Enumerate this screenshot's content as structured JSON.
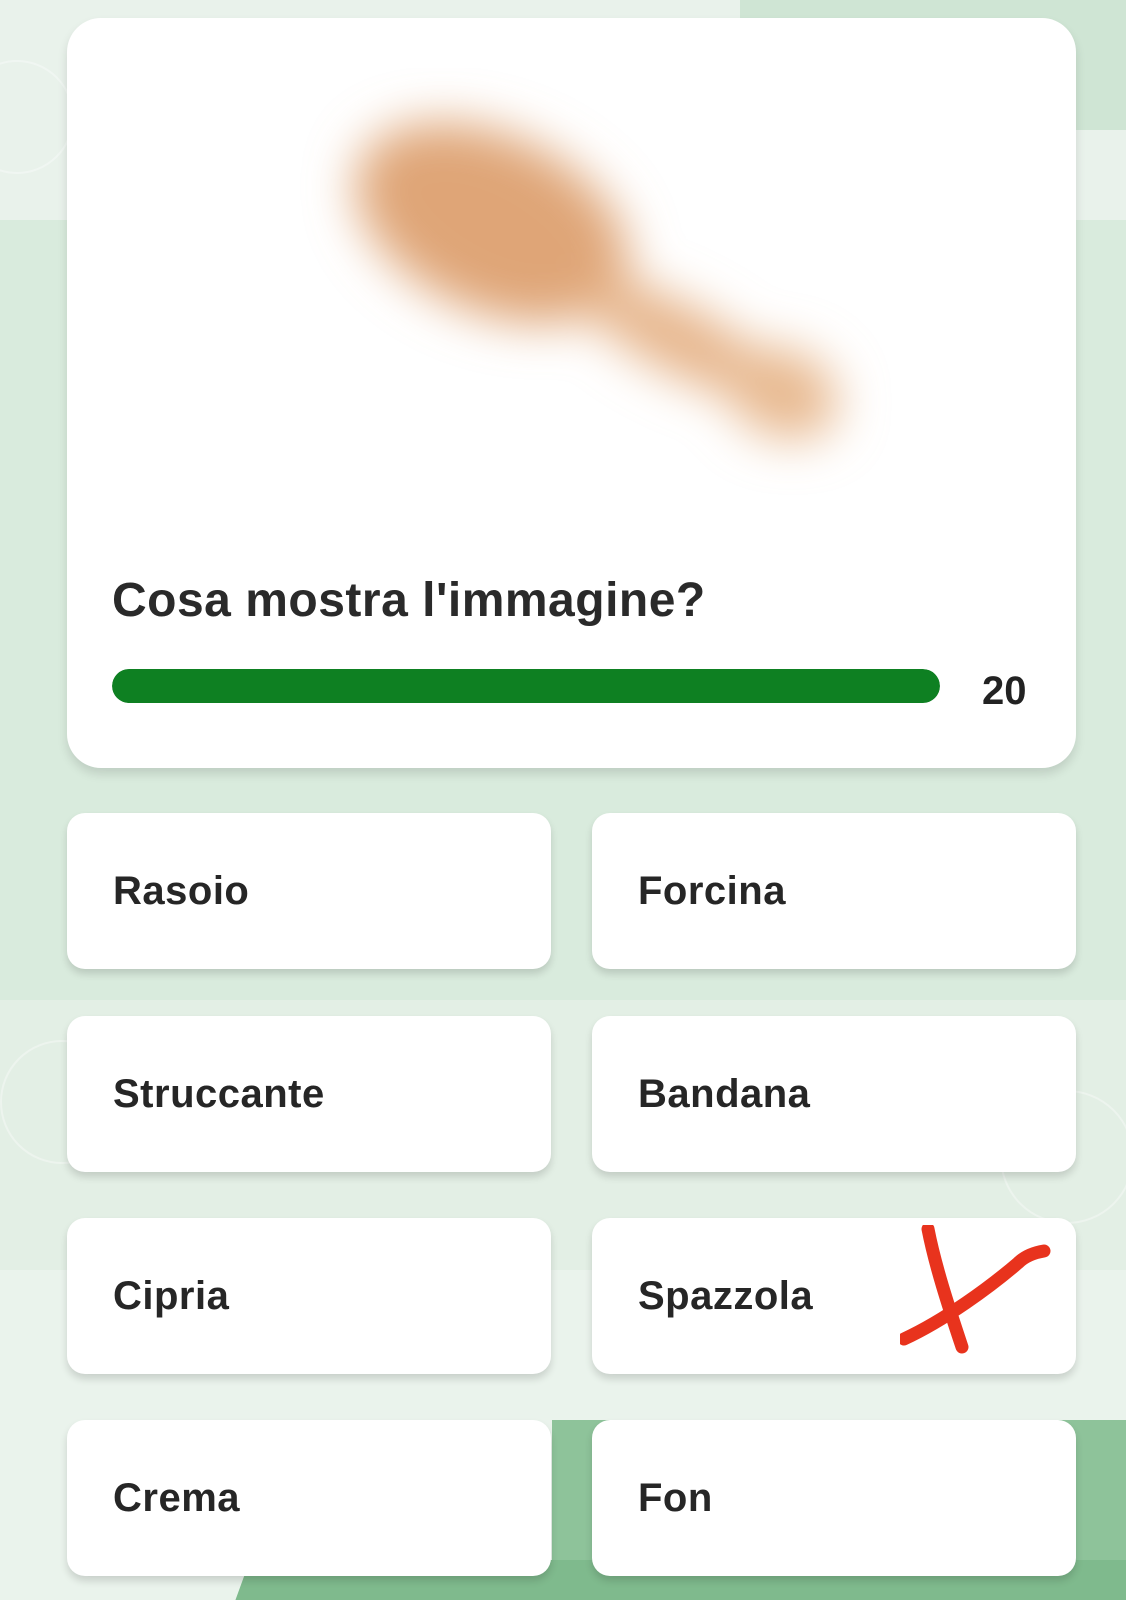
{
  "question": {
    "text": "Cosa mostra l'immagine?",
    "image_icon": "hairbrush-blurred-image"
  },
  "timer": {
    "count": "20",
    "progress_fraction": 1.0,
    "color": "#0e8022"
  },
  "answers": [
    {
      "label": "Rasoio"
    },
    {
      "label": "Forcina"
    },
    {
      "label": "Struccante"
    },
    {
      "label": "Bandana"
    },
    {
      "label": "Cipria"
    },
    {
      "label": "Spazzola"
    },
    {
      "label": "Crema"
    },
    {
      "label": "Fon"
    }
  ],
  "annotation": {
    "icon": "red-x-mark-icon",
    "color": "#e8331d"
  }
}
